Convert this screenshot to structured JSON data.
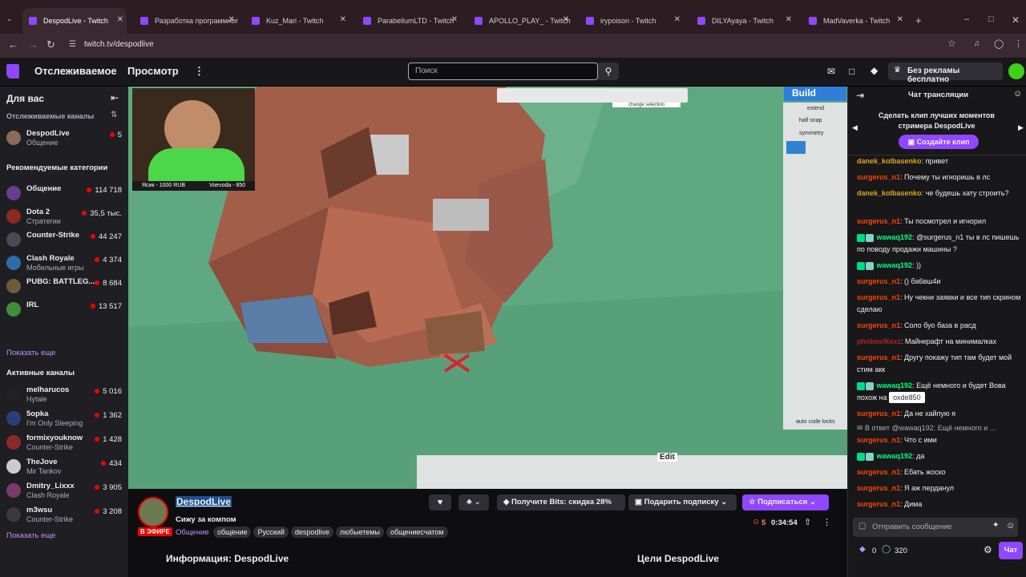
{
  "browser": {
    "tabs": [
      {
        "title": "DespodLive - Twitch",
        "active": true
      },
      {
        "title": "Разработка программного",
        "active": false
      },
      {
        "title": "Kuz_Mari - Twitch",
        "active": false
      },
      {
        "title": "ParabellumLTD - Twitch",
        "active": false
      },
      {
        "title": "APOLLO_PLAY_ - Twitch",
        "active": false
      },
      {
        "title": "irypoison - Twitch",
        "active": false
      },
      {
        "title": "DILYAyaya - Twitch",
        "active": false
      },
      {
        "title": "MadVaverka - Twitch",
        "active": false
      }
    ],
    "url": "twitch.tv/despodlive"
  },
  "topnav": {
    "following": "Отслеживаемое",
    "browse": "Просмотр",
    "search_placeholder": "Поиск",
    "ad_free": "Без рекламы бесплатно"
  },
  "sidebar": {
    "title": "Для вас",
    "followed_label": "Отслеживаемые каналы",
    "followed": [
      {
        "name": "DespodLive",
        "game": "Общение",
        "viewers": "5",
        "color": "#8a6b5a"
      }
    ],
    "recommended_label": "Рекомендуемые категории",
    "categories": [
      {
        "name": "Общение",
        "game": "",
        "viewers": "114 718",
        "color": "#6a3d8f"
      },
      {
        "name": "Dota 2",
        "game": "Стратегии",
        "viewers": "35,5 тыс.",
        "color": "#8b2a1e"
      },
      {
        "name": "Counter-Strike",
        "game": "",
        "viewers": "44 247",
        "color": "#4a4a52"
      },
      {
        "name": "Clash Royale",
        "game": "Мобильные игры",
        "viewers": "4 374",
        "color": "#2c6ea8"
      },
      {
        "name": "PUBG: BATTLEG...",
        "game": "",
        "viewers": "8 684",
        "color": "#6b5d3a"
      },
      {
        "name": "IRL",
        "game": "",
        "viewers": "13 517",
        "color": "#3f8f3a"
      }
    ],
    "show_more": "Показать еще",
    "active_label": "Активные каналы",
    "active": [
      {
        "name": "melharucos",
        "game": "Hytale",
        "viewers": "5 016",
        "color": "#222"
      },
      {
        "name": "5opka",
        "game": "I'm Only Sleeping",
        "viewers": "1 362",
        "color": "#2a3f7a"
      },
      {
        "name": "formixyouknow",
        "game": "Counter-Strike",
        "viewers": "1 428",
        "color": "#8a2a2a"
      },
      {
        "name": "TheJove",
        "game": "Mir Tankov",
        "viewers": "434",
        "color": "#cccccc"
      },
      {
        "name": "Dmitry_Lixxx",
        "game": "Clash Royale",
        "viewers": "3 905",
        "color": "#7a3a6a"
      },
      {
        "name": "m3wsu",
        "game": "Counter-Strike",
        "viewers": "3 208",
        "color": "#3a3a3a"
      }
    ],
    "show_more_2": "Показать еще"
  },
  "video": {
    "webcam_left": "Ясик - 1000 RUB",
    "webcam_right": "Voevoda - 850",
    "build_label": "Build",
    "hud_labels": [
      "extend",
      "half snap",
      "symmetry",
      "auto code locks",
      "change selection",
      "Edit"
    ]
  },
  "stream_info": {
    "channel": "DespodLive",
    "title": "Сижу за компом",
    "live": "В ЭФИРЕ",
    "category": "Общение",
    "tags": [
      "общение",
      "Русский",
      "despodlive",
      "любыетемы",
      "общениесчатом"
    ],
    "bits": "Получите Bits: скидка 28%",
    "gift": "Подарить подписку",
    "subscribe": "Подписаться",
    "viewers": "5",
    "uptime": "0:34:54",
    "about": "Информация: DespodLive",
    "goals": "Цели DespodLive"
  },
  "chat": {
    "title": "Чат трансляции",
    "clip_prompt": "Сделать клип лучших моментов стримера DespodLive",
    "clip_button": "Создайте клип",
    "messages": [
      {
        "user": "danek_kolbasenko",
        "color": "#daa520",
        "text": "привет",
        "badge": false
      },
      {
        "user": "surgerus_n1",
        "color": "#ff4500",
        "text": "Почему ты игноришь в лс",
        "badge": false
      },
      {
        "user": "danek_kolbasenko",
        "color": "#daa520",
        "text": "че будешь хату строить?",
        "badge": false
      },
      {
        "user": "surgerus_n1",
        "color": "#ff4500",
        "text": "Ты посмотрел и игнорил",
        "badge": false
      },
      {
        "user": "wawaq192",
        "color": "#00ff7f",
        "text": "@surgerus_n1 ты в лс пишешь по поводу продажи машины ?",
        "badge": true
      },
      {
        "user": "wawaq192",
        "color": "#00ff7f",
        "text": "))",
        "badge": true
      },
      {
        "user": "surgerus_n1",
        "color": "#ff4500",
        "text": "() ба6вш4и",
        "badge": false
      },
      {
        "user": "surgerus_n1",
        "color": "#ff4500",
        "text": "Ну чекни заявки и все тип скрином сделаю",
        "badge": false
      },
      {
        "user": "surgerus_n1",
        "color": "#ff4500",
        "text": "Соло буо база в расд",
        "badge": false
      },
      {
        "user": "phobosfkxxz",
        "color": "#b22222",
        "text": "Майнкрафт на минималках",
        "badge": false
      },
      {
        "user": "surgerus_n1",
        "color": "#ff4500",
        "text": "Другу покажу тип там будет мой стим акк",
        "badge": false
      },
      {
        "user": "wawaq192",
        "color": "#00ff7f",
        "text": "Ещё немного и будет Вова похож на",
        "badge": true,
        "emote": "oxde850"
      },
      {
        "user": "surgerus_n1",
        "color": "#ff4500",
        "text": "Да не хайпую я",
        "badge": false
      },
      {
        "user": "",
        "color": "#adadb8",
        "text": "В ответ @wawaq192: Ещё немного и ...",
        "badge": false,
        "reply": true
      },
      {
        "user": "surgerus_n1",
        "color": "#ff4500",
        "text": "Что с ими",
        "badge": false
      },
      {
        "user": "wawaq192",
        "color": "#00ff7f",
        "text": "да",
        "badge": true
      },
      {
        "user": "surgerus_n1",
        "color": "#ff4500",
        "text": "Ебать жоско",
        "badge": false
      },
      {
        "user": "surgerus_n1",
        "color": "#ff4500",
        "text": "Я аж перданул",
        "badge": false
      },
      {
        "user": "surgerus_n1",
        "color": "#ff4500",
        "text": "Дима",
        "badge": false
      }
    ],
    "input_placeholder": "Отправить сообщение",
    "bits_count": "0",
    "points": "320",
    "send_button": "Чат"
  },
  "colors": {
    "accent": "#9146ff",
    "live": "#eb0400",
    "link": "#bf94ff"
  }
}
